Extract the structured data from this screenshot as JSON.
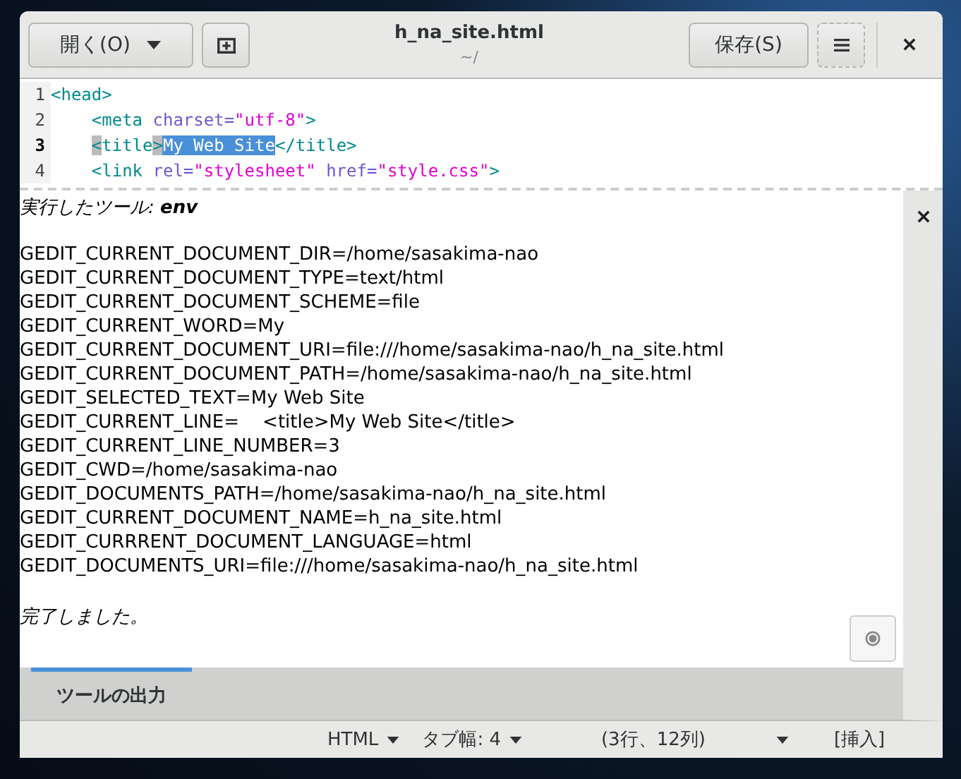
{
  "header": {
    "open_button": "開く(O)",
    "title": "h_na_site.html",
    "subtitle": "~/",
    "save_button": "保存(S)"
  },
  "editor": {
    "lines": [
      {
        "number": "1",
        "current": false,
        "indented": false,
        "segments": [
          {
            "kind": "tag",
            "text": "<head>",
            "selected": false,
            "bracket_match": false
          }
        ]
      },
      {
        "number": "2",
        "current": false,
        "indented": true,
        "segments": [
          {
            "kind": "tag",
            "text": "<meta ",
            "selected": false,
            "bracket_match": false
          },
          {
            "kind": "attr",
            "text": "charset=",
            "selected": false,
            "bracket_match": false
          },
          {
            "kind": "string",
            "text": "\"utf-8\"",
            "selected": false,
            "bracket_match": false
          },
          {
            "kind": "tag",
            "text": ">",
            "selected": false,
            "bracket_match": false
          }
        ]
      },
      {
        "number": "3",
        "current": true,
        "indented": true,
        "segments": [
          {
            "kind": "tag",
            "text": "<",
            "selected": false,
            "bracket_match": true
          },
          {
            "kind": "tag",
            "text": "title",
            "selected": false,
            "bracket_match": false
          },
          {
            "kind": "tag",
            "text": ">",
            "selected": false,
            "bracket_match": true
          },
          {
            "kind": "plain",
            "text": "My Web Site",
            "selected": true,
            "bracket_match": false
          },
          {
            "kind": "tag",
            "text": "</title>",
            "selected": false,
            "bracket_match": false
          }
        ]
      },
      {
        "number": "4",
        "current": false,
        "indented": true,
        "segments": [
          {
            "kind": "tag",
            "text": "<link ",
            "selected": false,
            "bracket_match": false
          },
          {
            "kind": "attr",
            "text": "rel=",
            "selected": false,
            "bracket_match": false
          },
          {
            "kind": "string",
            "text": "\"stylesheet\"",
            "selected": false,
            "bracket_match": false
          },
          {
            "kind": "attr",
            "text": " href=",
            "selected": false,
            "bracket_match": false
          },
          {
            "kind": "string",
            "text": "\"style.css\"",
            "selected": false,
            "bracket_match": false
          },
          {
            "kind": "tag",
            "text": ">",
            "selected": false,
            "bracket_match": false
          }
        ]
      }
    ]
  },
  "output": {
    "heading": "*実行したツール:* **env**",
    "lines": [
      "GEDIT_CURRENT_DOCUMENT_DIR=/home/sasakima-nao",
      "GEDIT_CURRENT_DOCUMENT_TYPE=text/html",
      "GEDIT_CURRENT_DOCUMENT_SCHEME=file",
      "GEDIT_CURRENT_WORD=My",
      "GEDIT_CURRENT_DOCUMENT_URI=file:///home/sasakima-nao/h_na_site.html",
      "GEDIT_CURRENT_DOCUMENT_PATH=/home/sasakima-nao/h_na_site.html",
      "GEDIT_SELECTED_TEXT=My Web Site",
      "GEDIT_CURRENT_LINE=    <title>My Web Site</title>",
      "GEDIT_CURRENT_LINE_NUMBER=3",
      "GEDIT_CWD=/home/sasakima-nao",
      "GEDIT_DOCUMENTS_PATH=/home/sasakima-nao/h_na_site.html",
      "GEDIT_CURRENT_DOCUMENT_NAME=h_na_site.html",
      "GEDIT_CURRRENT_DOCUMENT_LANGUAGE=html",
      "GEDIT_DOCUMENTS_URI=file:///home/sasakima-nao/h_na_site.html"
    ],
    "footer": "完了しました。"
  },
  "tabs": [
    {
      "label": "ツールの出力",
      "selected": true
    }
  ],
  "status_bar": {
    "language": "HTML",
    "tab_width": "タブ幅: 4",
    "position": "(3行、12列)",
    "mode": "[挿入]"
  }
}
